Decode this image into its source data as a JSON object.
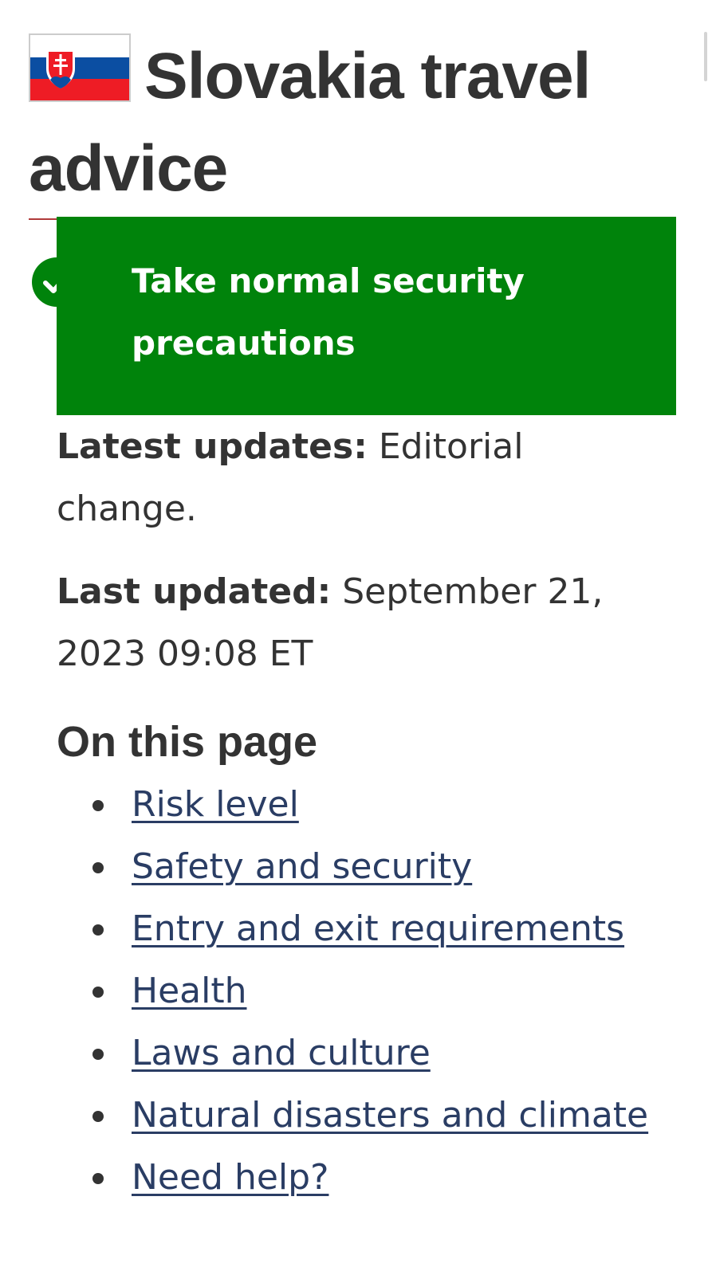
{
  "header": {
    "flag_icon": "slovakia-flag-icon",
    "title": "Slovakia travel advice"
  },
  "banner": {
    "icon": "checkmark-circle-icon",
    "text": "Take normal security precautions",
    "color": "#00830b"
  },
  "latest_updates": {
    "label": "Latest updates:",
    "value": "Editorial change."
  },
  "last_updated": {
    "label": "Last updated:",
    "value": "September 21, 2023 09:08 ET"
  },
  "toc": {
    "heading": "On this page",
    "items": [
      {
        "label": "Risk level"
      },
      {
        "label": "Safety and security"
      },
      {
        "label": "Entry and exit requirements"
      },
      {
        "label": "Health"
      },
      {
        "label": "Laws and culture"
      },
      {
        "label": "Natural disasters and climate"
      },
      {
        "label": "Need help?"
      }
    ]
  },
  "colors": {
    "link": "#2a3d64",
    "title_rule": "#b03a3a",
    "text": "#333333"
  }
}
